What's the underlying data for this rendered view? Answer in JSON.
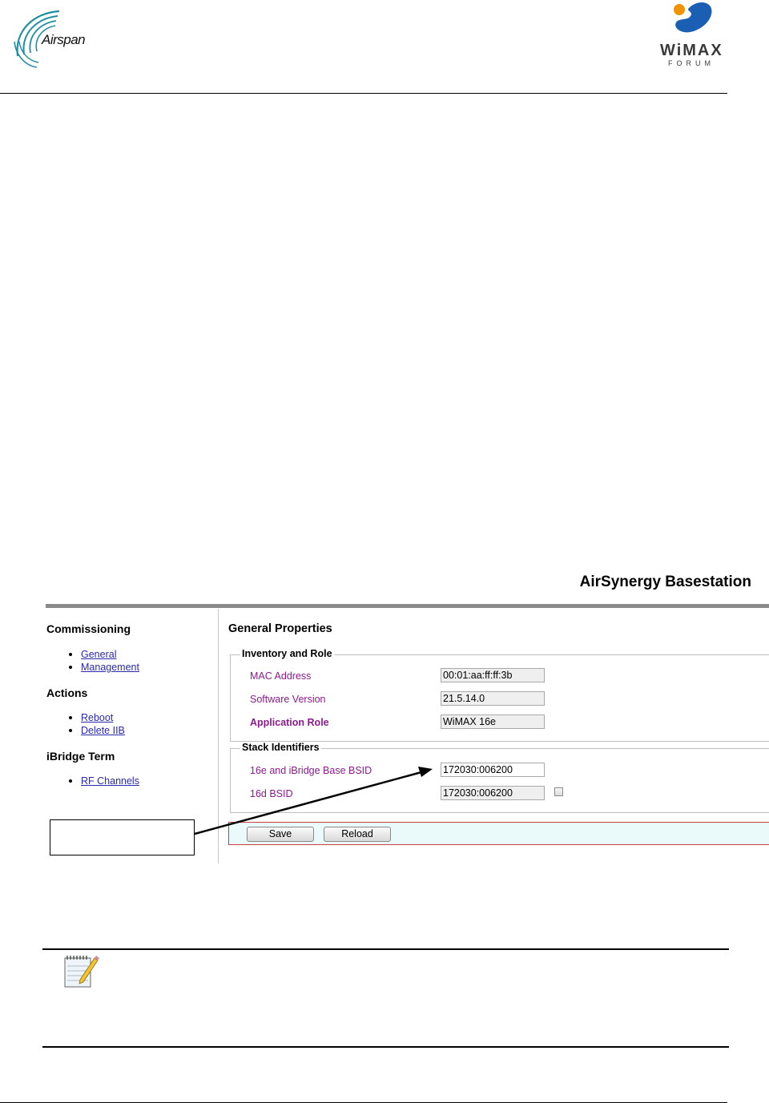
{
  "header": {
    "company_logo_text": "Airspan",
    "wimax_logo_text": "WiMAX",
    "wimax_logo_subtext": "FORUM"
  },
  "app": {
    "title": "AirSynergy Basestation",
    "sidebar": {
      "sections": [
        {
          "heading": "Commissioning",
          "items": [
            "General",
            "Management"
          ]
        },
        {
          "heading": "Actions",
          "items": [
            "Reboot",
            "Delete IIB"
          ]
        },
        {
          "heading": "iBridge Term",
          "items": [
            "RF Channels"
          ]
        }
      ]
    },
    "main": {
      "title": "General Properties",
      "inventory_group": {
        "legend": "Inventory and Role",
        "fields": [
          {
            "label": "MAC Address",
            "value": "00:01:aa:ff:ff:3b"
          },
          {
            "label": "Software Version",
            "value": "21.5.14.0"
          },
          {
            "label": "Application Role",
            "value": "WiMAX 16e"
          }
        ]
      },
      "stack_group": {
        "legend": "Stack Identifiers",
        "fields": [
          {
            "label": "16e and iBridge Base BSID",
            "value": "172030:006200"
          },
          {
            "label": "16d BSID",
            "value": "172030:006200",
            "checkbox_checked": false
          }
        ]
      },
      "buttons": {
        "save": "Save",
        "reload": "Reload"
      }
    }
  },
  "colors": {
    "label": "#8b1a8b",
    "link": "#2a2ab0",
    "button_bar_bg": "#eafafa",
    "button_bar_border": "#c84040",
    "wimax_blue": "#1a5fb4",
    "wimax_orange": "#f39200",
    "airspan_teal": "#1e8fa0"
  },
  "icons": {
    "note": "notepad-pencil-icon",
    "company": "airspan-arcs-logo",
    "forum": "wimax-forum-logo"
  }
}
